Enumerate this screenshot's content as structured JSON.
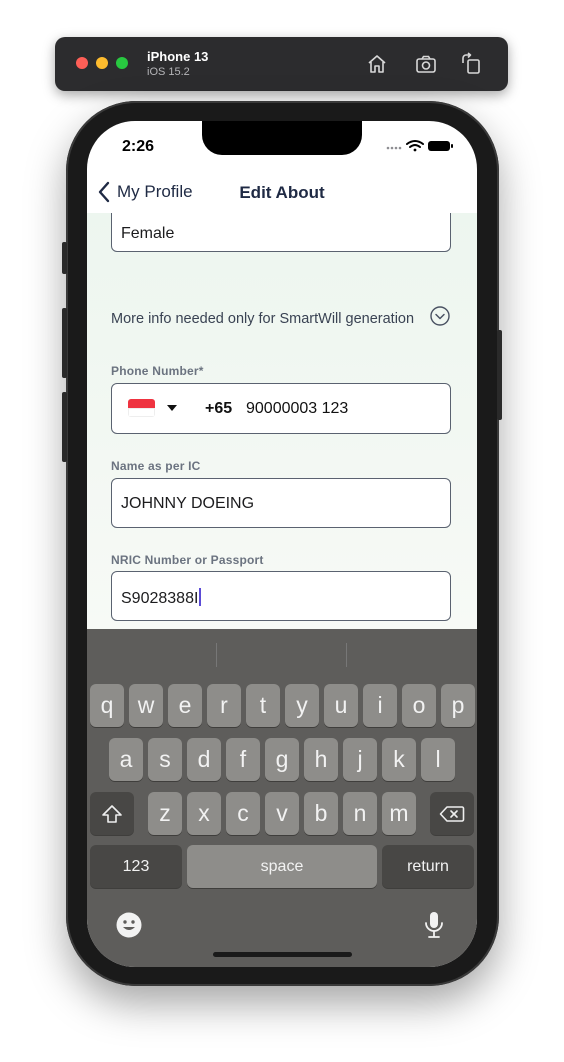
{
  "simulator": {
    "device_name": "iPhone 13",
    "os_version": "iOS 15.2",
    "buttons": [
      "home-icon",
      "screenshot-icon",
      "rotate-icon"
    ]
  },
  "status_bar": {
    "time": "2:26"
  },
  "nav": {
    "back_label": "My Profile",
    "title": "Edit About"
  },
  "form": {
    "gender_value": "Female",
    "more_info_text": "More info needed only for SmartWill generation",
    "phone_label": "Phone Number*",
    "phone_country_code": "+65",
    "phone_value": "90000003 123",
    "name_label": "Name as per IC",
    "name_value": "JOHNNY DOEING",
    "nric_label": "NRIC Number or Passport",
    "nric_value": "S9028388I"
  },
  "keyboard": {
    "row1": [
      "q",
      "w",
      "e",
      "r",
      "t",
      "y",
      "u",
      "i",
      "o",
      "p"
    ],
    "row2": [
      "a",
      "s",
      "d",
      "f",
      "g",
      "h",
      "j",
      "k",
      "l"
    ],
    "row3": [
      "z",
      "x",
      "c",
      "v",
      "b",
      "n",
      "m"
    ],
    "numbers_key": "123",
    "space_key": "space",
    "return_key": "return"
  }
}
